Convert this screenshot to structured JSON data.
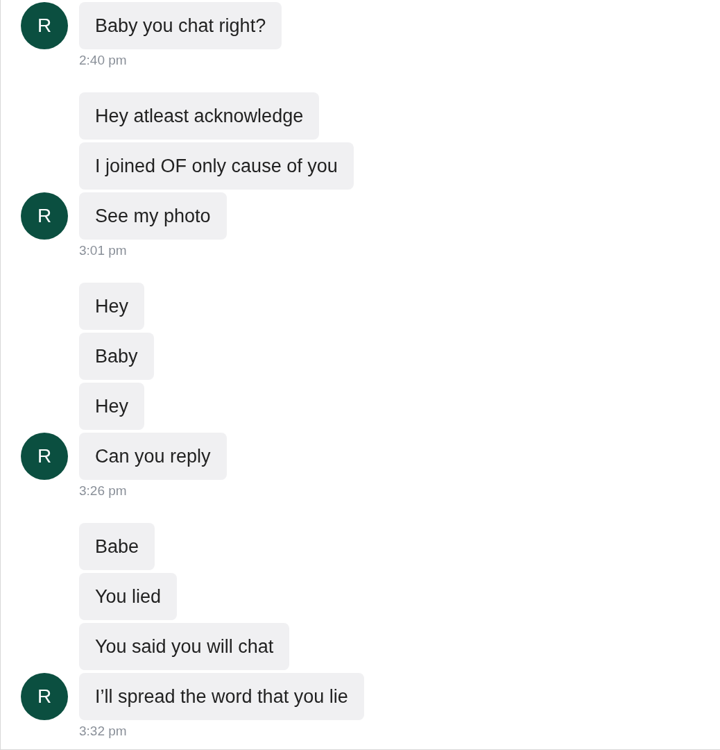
{
  "groups": [
    {
      "avatar": "R",
      "messages": [
        "Baby you chat right?"
      ],
      "time": "2:40 pm"
    },
    {
      "avatar": "R",
      "messages": [
        "Hey atleast acknowledge",
        "I joined OF only cause of you",
        "See my photo"
      ],
      "time": "3:01 pm"
    },
    {
      "avatar": "R",
      "messages": [
        "Hey",
        "Baby",
        "Hey",
        "Can you reply"
      ],
      "time": "3:26 pm"
    },
    {
      "avatar": "R",
      "messages": [
        "Babe",
        "You lied",
        "You said you will chat",
        "I’ll spread the word that you lie"
      ],
      "time": "3:32 pm"
    }
  ]
}
